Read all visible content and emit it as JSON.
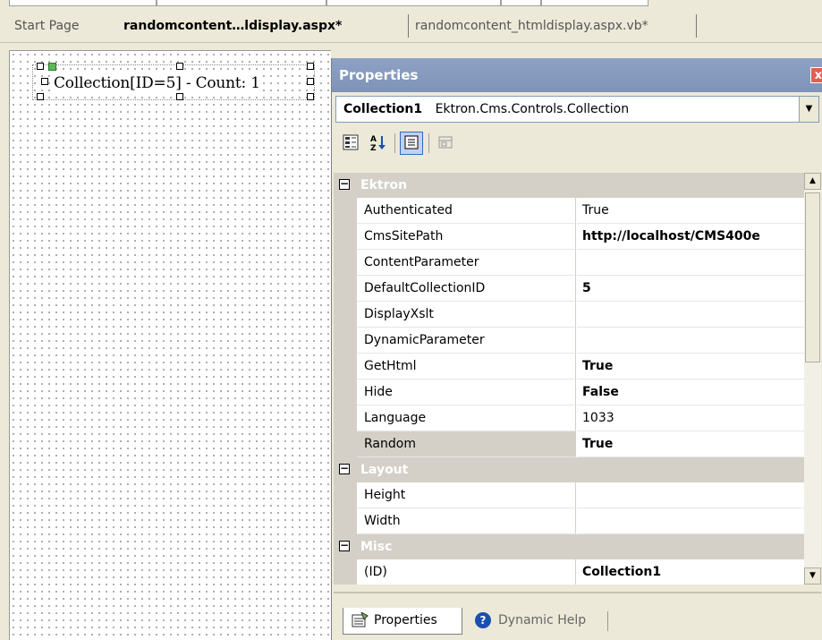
{
  "tabs": [
    {
      "label": "Start Page",
      "active": false
    },
    {
      "label": "randomcontent…ldisplay.aspx*",
      "active": true
    },
    {
      "label": "randomcontent_htmldisplay.aspx.vb*",
      "active": false
    }
  ],
  "designer": {
    "control_label": "Collection[ID=5] - Count: 1"
  },
  "properties": {
    "title": "Properties",
    "close_glyph": "x",
    "object_name": "Collection1",
    "object_type": "Ektron.Cms.Controls.Collection",
    "categories": [
      {
        "name": "Ektron",
        "toggle": "−",
        "rows": [
          {
            "name": "Authenticated",
            "value": "True",
            "bold": false
          },
          {
            "name": "CmsSitePath",
            "value": "http://localhost/CMS400e",
            "bold": true
          },
          {
            "name": "ContentParameter",
            "value": "",
            "bold": false
          },
          {
            "name": "DefaultCollectionID",
            "value": "5",
            "bold": true
          },
          {
            "name": "DisplayXslt",
            "value": "",
            "bold": false
          },
          {
            "name": "DynamicParameter",
            "value": "",
            "bold": false
          },
          {
            "name": "GetHtml",
            "value": "True",
            "bold": true
          },
          {
            "name": "Hide",
            "value": "False",
            "bold": true
          },
          {
            "name": "Language",
            "value": "1033",
            "bold": false
          },
          {
            "name": "Random",
            "value": "True",
            "bold": true,
            "selected": true
          }
        ]
      },
      {
        "name": "Layout",
        "toggle": "−",
        "rows": [
          {
            "name": "Height",
            "value": "",
            "bold": false
          },
          {
            "name": "Width",
            "value": "",
            "bold": false
          }
        ]
      },
      {
        "name": "Misc",
        "toggle": "−",
        "rows": [
          {
            "name": "(ID)",
            "value": "Collection1",
            "bold": true
          }
        ]
      }
    ],
    "bottom_tabs": [
      {
        "label": "Properties",
        "icon": "properties-icon",
        "active": true
      },
      {
        "label": "Dynamic Help",
        "icon": "help-icon",
        "active": false
      }
    ]
  },
  "colors": {
    "title_bar": "#8da2c4",
    "category_row": "#d4d0c8",
    "chrome": "#ece9d8"
  }
}
